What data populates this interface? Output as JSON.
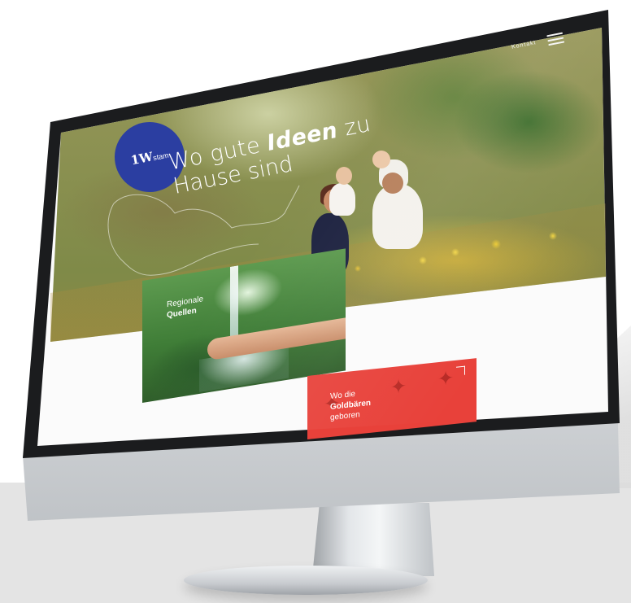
{
  "nav": {
    "contact_label": "Kontakt",
    "menu_icon": "hamburger-menu-icon"
  },
  "logo": {
    "mark": "1W",
    "suffix": "stam"
  },
  "hero": {
    "headline_pre": "Wo gute ",
    "headline_bold": "Ideen",
    "headline_post": " zu",
    "headline_line2": "Hause sind"
  },
  "cards": {
    "water": {
      "subtitle": "Regionale",
      "title": "Quellen"
    },
    "bears": {
      "line1": "Wo die",
      "title": "Goldbären",
      "line3": "geboren"
    }
  },
  "colors": {
    "logo_blue": "#2b3ea1",
    "bears_red": "#e8413a",
    "frame": "#1b1c1e"
  }
}
